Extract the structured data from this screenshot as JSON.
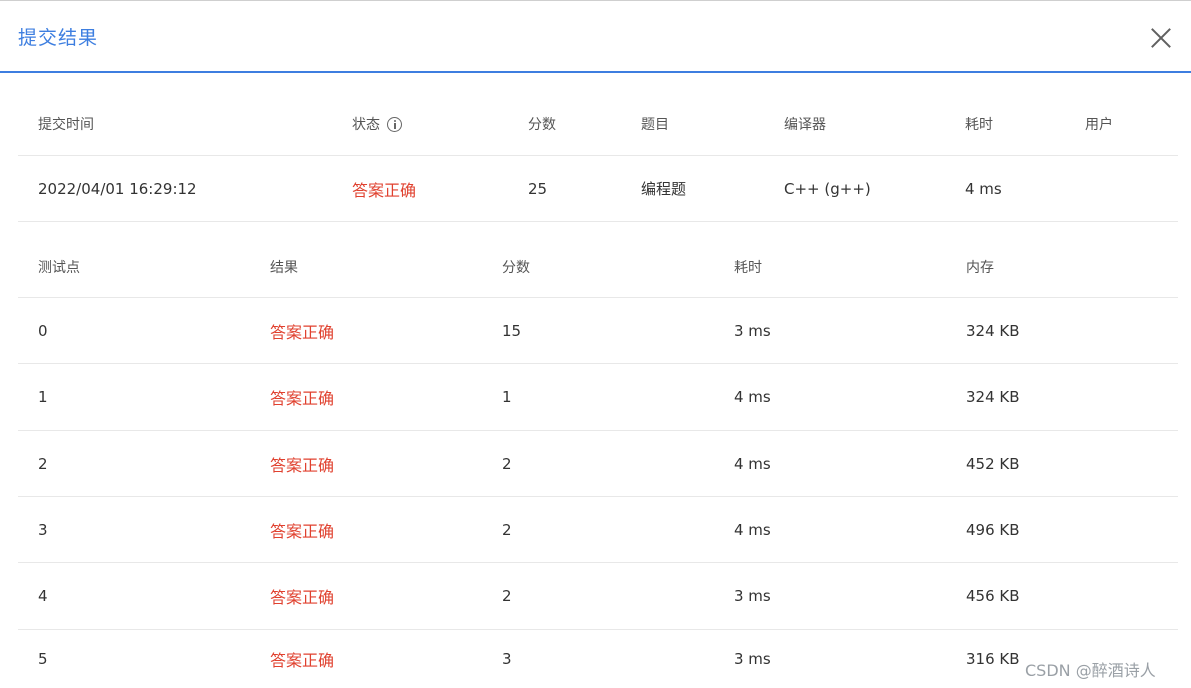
{
  "dialog": {
    "title": "提交结果"
  },
  "summary": {
    "headers": [
      "提交时间",
      "状态",
      "分数",
      "题目",
      "编译器",
      "耗时",
      "用户"
    ],
    "row": [
      "2022/04/01 16:29:12",
      "答案正确",
      "25",
      "编程题",
      "C++ (g++)",
      "4 ms",
      ""
    ]
  },
  "testcases": {
    "headers": [
      "测试点",
      "结果",
      "分数",
      "耗时",
      "内存"
    ],
    "rows": [
      [
        "0",
        "答案正确",
        "15",
        "3 ms",
        "324 KB"
      ],
      [
        "1",
        "答案正确",
        "1",
        "4 ms",
        "324 KB"
      ],
      [
        "2",
        "答案正确",
        "2",
        "4 ms",
        "452 KB"
      ],
      [
        "3",
        "答案正确",
        "2",
        "4 ms",
        "496 KB"
      ],
      [
        "4",
        "答案正确",
        "2",
        "3 ms",
        "456 KB"
      ],
      [
        "5",
        "答案正确",
        "3",
        "3 ms",
        "316 KB"
      ]
    ]
  },
  "watermark": "CSDN @醉酒诗人",
  "colors": {
    "accent": "#3d7ee0",
    "status_ok": "#e0412f"
  }
}
